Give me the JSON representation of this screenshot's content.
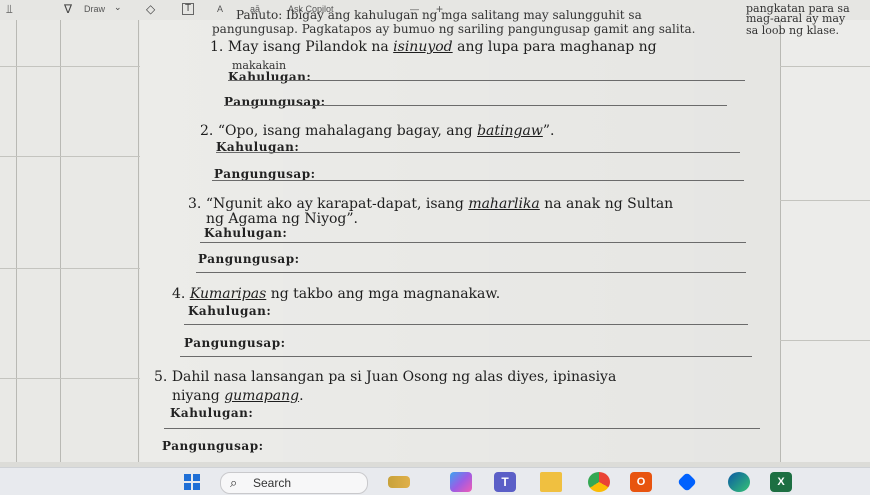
{
  "toolbar": {
    "draw_label": "Draw",
    "font_size_label": "A",
    "read_aloud_label": "aā",
    "ask_label": "Ask Copilot",
    "minus": "—",
    "plus": "+"
  },
  "document": {
    "instruction_line1": "Panuto: Ibigay ang kahulugan ng mga salitang may salungguhit sa",
    "instruction_line2": "pangungusap. Pagkatapos ay bumuo ng sariling pangungusap gamit ang salita.",
    "side_note": [
      "pangkatan para sa",
      "mag-aaral ay may",
      "sa loob ng klase."
    ],
    "items": [
      {
        "number": "1.",
        "before": "May isang Pilandok na ",
        "word": "isinuyod",
        "after": " ang lupa para maghanap ng",
        "continuation": "",
        "answer": "makakain",
        "kahulugan": "Kahulugan:",
        "pangungusap": "Pangungusap:"
      },
      {
        "number": "2.",
        "before": "“Opo, isang mahalagang bagay, ang ",
        "word": "batingaw",
        "after": "”.",
        "continuation": "",
        "answer": "",
        "kahulugan": "Kahulugan:",
        "pangungusap": "Pangungusap:"
      },
      {
        "number": "3.",
        "before": "“Ngunit ako ay karapat-dapat, isang ",
        "word": "maharlika",
        "after": " na anak ng Sultan",
        "continuation": "ng Agama ng Niyog”.",
        "answer": "",
        "kahulugan": "Kahulugan:",
        "pangungusap": "Pangungusap:"
      },
      {
        "number": "4.",
        "before": "",
        "word": "Kumaripas",
        "after": " ng takbo ang mga magnanakaw.",
        "continuation": "",
        "answer": "",
        "kahulugan": "Kahulugan:",
        "pangungusap": "Pangungusap:"
      },
      {
        "number": "5.",
        "before": "Dahil nasa lansangan pa si Juan Osong ng  alas diyes, ipinasiya",
        "word": "gumapang",
        "after": ".",
        "continuation": "niyang ",
        "answer": "",
        "kahulugan": "Kahulugan:",
        "pangungusap": "Pangungusap:"
      }
    ]
  },
  "taskbar": {
    "search_label": "Search"
  },
  "colors": {
    "page": "#f2f2ef",
    "taskbar": "#e8eaee",
    "windows_blue": "#1f6fd6"
  }
}
